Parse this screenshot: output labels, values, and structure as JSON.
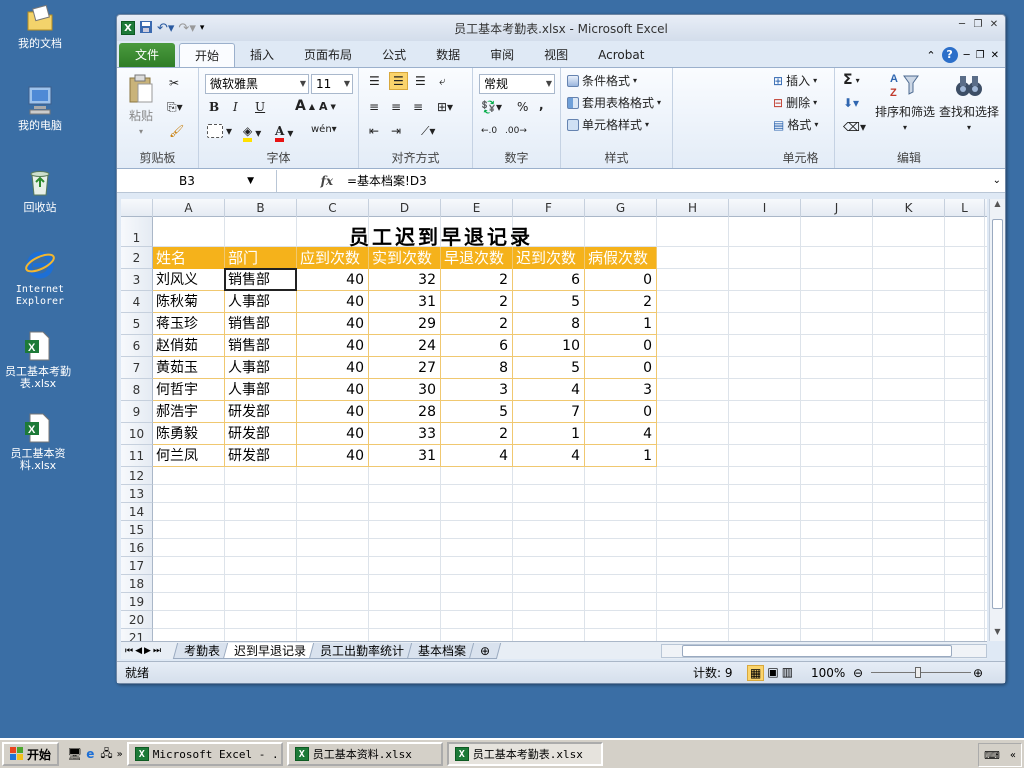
{
  "desktop": {
    "icons": [
      {
        "label": "我的文档",
        "icon": "folder-docs-icon"
      },
      {
        "label": "我的电脑",
        "icon": "computer-icon"
      },
      {
        "label": "回收站",
        "icon": "recycle-bin-icon"
      },
      {
        "label": "Internet Explorer",
        "icon": "ie-icon"
      },
      {
        "label": "员工基本考勤表.xlsx",
        "icon": "excel-file-icon"
      },
      {
        "label": "员工基本资料.xlsx",
        "icon": "excel-file-icon"
      }
    ]
  },
  "window": {
    "title": "员工基本考勤表.xlsx - Microsoft Excel",
    "tabs": [
      "文件",
      "开始",
      "插入",
      "页面布局",
      "公式",
      "数据",
      "审阅",
      "视图",
      "Acrobat"
    ],
    "active_tab": "开始"
  },
  "ribbon": {
    "clipboard": {
      "label": "剪贴板",
      "paste": "粘贴"
    },
    "font": {
      "label": "字体",
      "font_name": "微软雅黑",
      "font_size": "11",
      "bold": "B",
      "italic": "I",
      "underline": "U"
    },
    "alignment": {
      "label": "对齐方式"
    },
    "number": {
      "label": "数字",
      "format": "常规",
      "percent": "%",
      "comma": ","
    },
    "styles": {
      "label": "样式",
      "conditional": "条件格式",
      "table_format": "套用表格格式",
      "cell_style": "单元格样式"
    },
    "cells": {
      "label": "单元格",
      "insert": "插入",
      "delete": "删除",
      "format": "格式"
    },
    "editing": {
      "label": "编辑",
      "sort_filter": "排序和筛选",
      "find_select": "查找和选择",
      "sigma": "Σ"
    }
  },
  "formula_bar": {
    "name_box": "B3",
    "fx": "fx",
    "formula": "=基本档案!D3"
  },
  "sheet": {
    "columns": [
      "A",
      "B",
      "C",
      "D",
      "E",
      "F",
      "G",
      "H",
      "I",
      "J",
      "K",
      "L"
    ],
    "rows": [
      "1",
      "2",
      "3",
      "4",
      "5",
      "6",
      "7",
      "8",
      "9",
      "10",
      "11",
      "12",
      "13",
      "14",
      "15",
      "16",
      "17",
      "18",
      "19",
      "20",
      "21"
    ],
    "title": "员工迟到早退记录",
    "headers": [
      "姓名",
      "部门",
      "应到次数",
      "实到次数",
      "早退次数",
      "迟到次数",
      "病假次数"
    ],
    "data": [
      [
        "刘风义",
        "销售部",
        "40",
        "32",
        "2",
        "6",
        "0"
      ],
      [
        "陈秋菊",
        "人事部",
        "40",
        "31",
        "2",
        "5",
        "2"
      ],
      [
        "蒋玉珍",
        "销售部",
        "40",
        "29",
        "2",
        "8",
        "1"
      ],
      [
        "赵俏茹",
        "销售部",
        "40",
        "24",
        "6",
        "10",
        "0"
      ],
      [
        "黄茹玉",
        "人事部",
        "40",
        "27",
        "8",
        "5",
        "0"
      ],
      [
        "何哲宇",
        "人事部",
        "40",
        "30",
        "3",
        "4",
        "3"
      ],
      [
        "郝浩宇",
        "研发部",
        "40",
        "28",
        "5",
        "7",
        "0"
      ],
      [
        "陈勇毅",
        "研发部",
        "40",
        "33",
        "2",
        "1",
        "4"
      ],
      [
        "何兰凤",
        "研发部",
        "40",
        "31",
        "4",
        "4",
        "1"
      ]
    ],
    "header_color": "#f5b21b"
  },
  "sheet_tabs": [
    "考勤表",
    "迟到早退记录",
    "员工出勤率统计",
    "基本档案"
  ],
  "active_sheet": "迟到早退记录",
  "status": {
    "ready": "就绪",
    "count": "计数: 9",
    "zoom": "100%"
  },
  "taskbar": {
    "start": "开始",
    "buttons": [
      "Microsoft Excel - ...",
      "员工基本资料.xlsx",
      "员工基本考勤表.xlsx"
    ]
  }
}
